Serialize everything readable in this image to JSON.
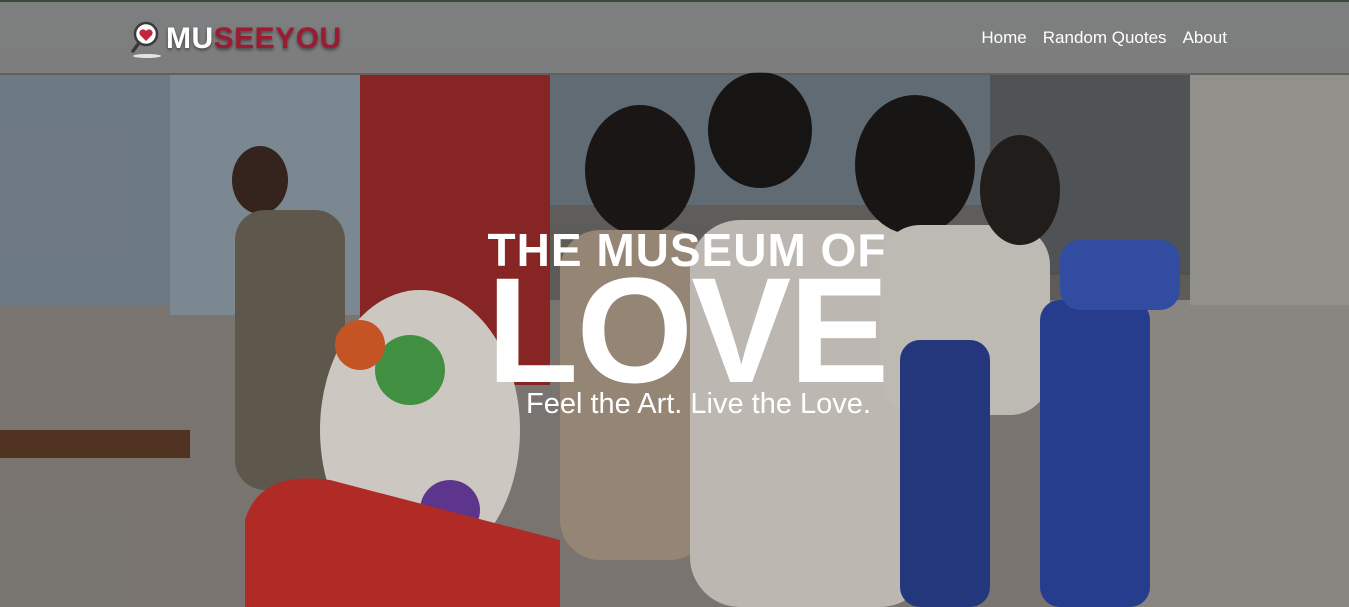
{
  "brand": {
    "part1": "MU",
    "part2": "SEEYOU",
    "icon": "magnifier-heart-icon",
    "colors": {
      "accent": "#9b1b32",
      "text": "#ffffff"
    }
  },
  "nav": {
    "items": [
      {
        "label": "Home"
      },
      {
        "label": "Random Quotes"
      },
      {
        "label": "About"
      }
    ]
  },
  "hero": {
    "title_line1": "THE MUSEUM OF",
    "title_line2": "LOVE",
    "tagline": "Feel the Art. Live the Love.",
    "background": "mall-photo-couple-on-kiddie-train"
  }
}
